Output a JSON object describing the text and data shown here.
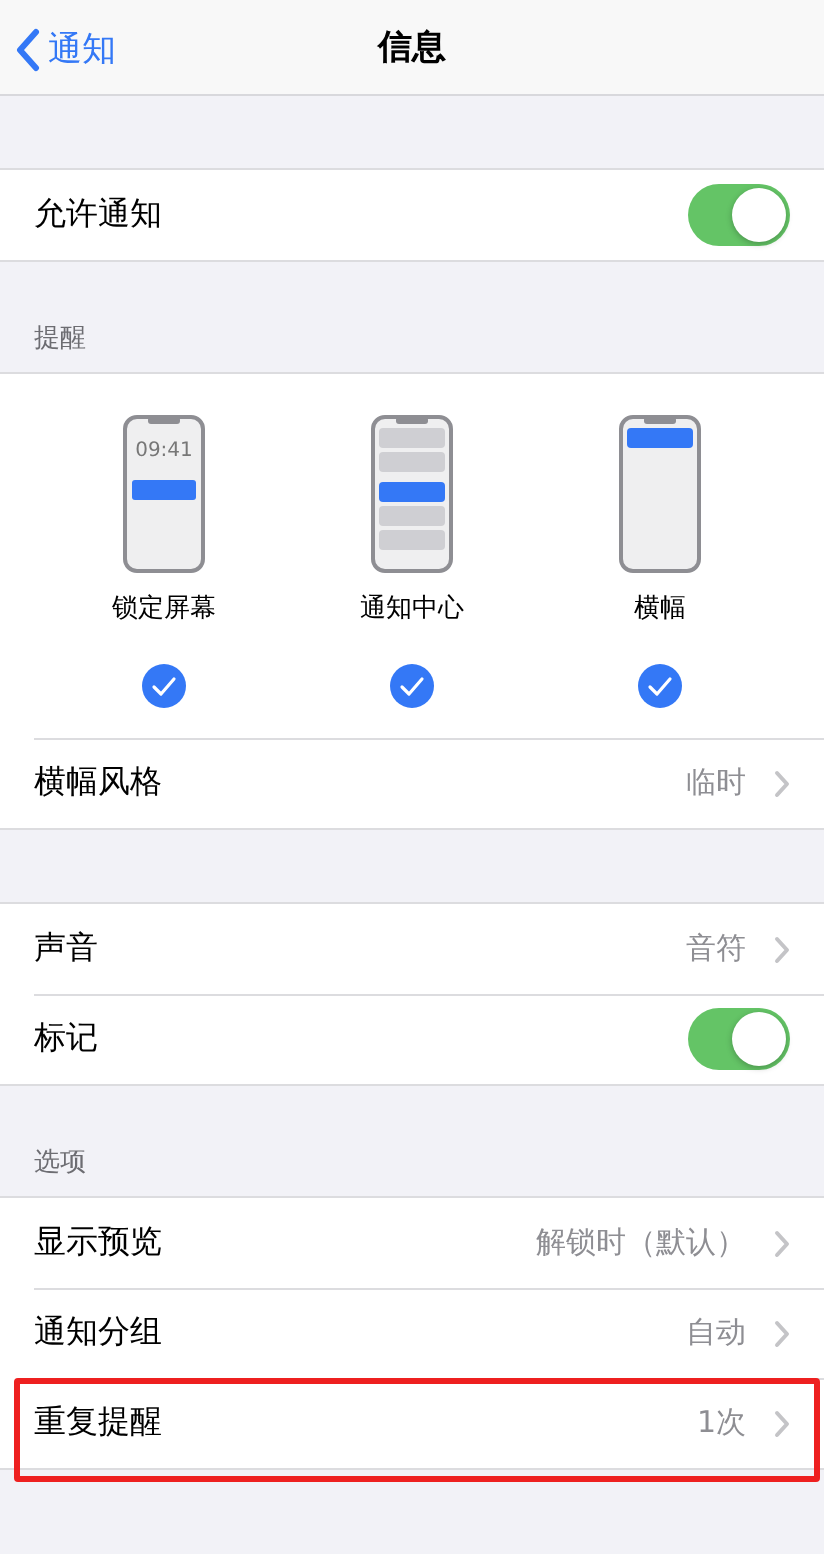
{
  "nav": {
    "back": "通知",
    "title": "信息"
  },
  "sections": [
    {
      "rows": [
        {
          "kind": "toggle",
          "label": "允许通知",
          "on": true
        }
      ]
    },
    {
      "header": "提醒",
      "alert_styles": [
        {
          "kind": "lock",
          "label": "锁定屏幕",
          "time": "09:41",
          "checked": true
        },
        {
          "kind": "center",
          "label": "通知中心",
          "checked": true
        },
        {
          "kind": "banner",
          "label": "横幅",
          "checked": true
        }
      ],
      "rows": [
        {
          "kind": "link",
          "label": "横幅风格",
          "value": "临时"
        }
      ]
    },
    {
      "rows": [
        {
          "kind": "link",
          "label": "声音",
          "value": "音符"
        },
        {
          "kind": "toggle",
          "label": "标记",
          "on": true
        }
      ]
    },
    {
      "header": "选项",
      "rows": [
        {
          "kind": "link",
          "label": "显示预览",
          "value": "解锁时（默认）"
        },
        {
          "kind": "link",
          "label": "通知分组",
          "value": "自动"
        },
        {
          "kind": "link",
          "label": "重复提醒",
          "value": "1次",
          "highlighted": true
        }
      ]
    }
  ]
}
